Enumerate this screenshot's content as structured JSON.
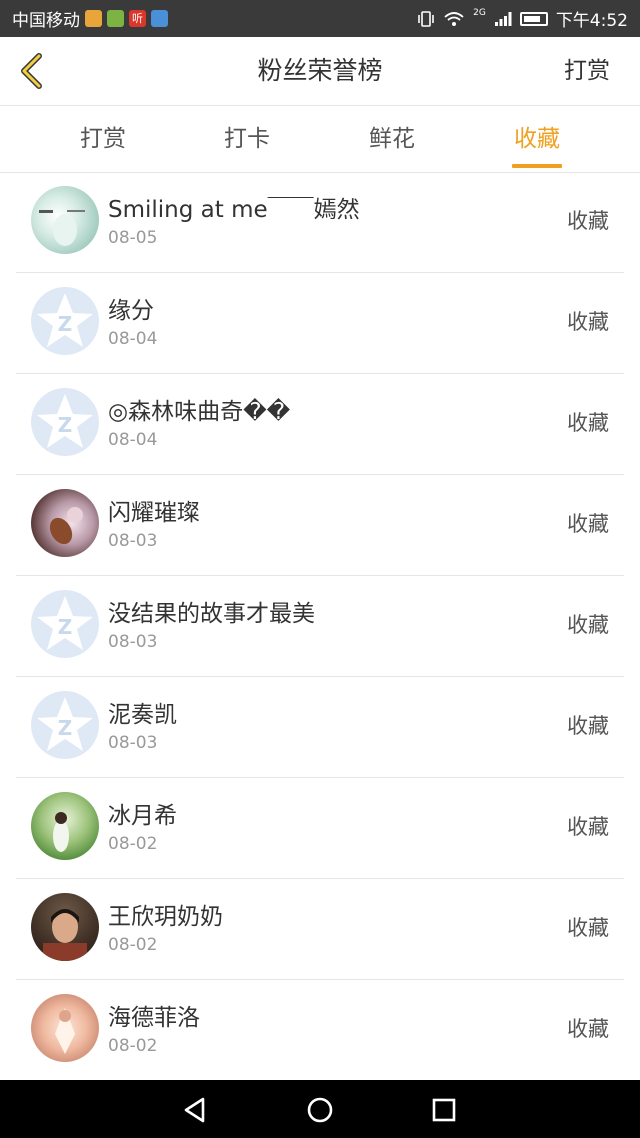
{
  "status_bar": {
    "carrier": "中国移动",
    "app_icon_4_label": "听",
    "network": "2G",
    "time": "下午4:52"
  },
  "header": {
    "title": "粉丝荣誉榜",
    "right_action": "打赏",
    "back_icon": "chevron-left-icon"
  },
  "tabs": [
    {
      "label": "打赏",
      "active": false
    },
    {
      "label": "打卡",
      "active": false
    },
    {
      "label": "鲜花",
      "active": false
    },
    {
      "label": "收藏",
      "active": true
    }
  ],
  "accent_color": "#f0a020",
  "list": [
    {
      "name": "Smiling at me￣￣嫣然",
      "date": "08-05",
      "action": "收藏",
      "avatar": "photo"
    },
    {
      "name": "缘分",
      "date": "08-04",
      "action": "收藏",
      "avatar": "default"
    },
    {
      "name": "◎森林味曲奇��",
      "date": "08-04",
      "action": "收藏",
      "avatar": "default"
    },
    {
      "name": "闪耀璀璨",
      "date": "08-03",
      "action": "收藏",
      "avatar": "photo"
    },
    {
      "name": "没结果的故事才最美",
      "date": "08-03",
      "action": "收藏",
      "avatar": "default"
    },
    {
      "name": "泥奏凯",
      "date": "08-03",
      "action": "收藏",
      "avatar": "default"
    },
    {
      "name": "冰月希",
      "date": "08-02",
      "action": "收藏",
      "avatar": "photo"
    },
    {
      "name": "王欣玥奶奶",
      "date": "08-02",
      "action": "收藏",
      "avatar": "photo"
    },
    {
      "name": "海德菲洛",
      "date": "08-02",
      "action": "收藏",
      "avatar": "photo"
    }
  ],
  "nav_bar": {
    "back": "triangle-back-icon",
    "home": "circle-home-icon",
    "recents": "square-recents-icon"
  }
}
